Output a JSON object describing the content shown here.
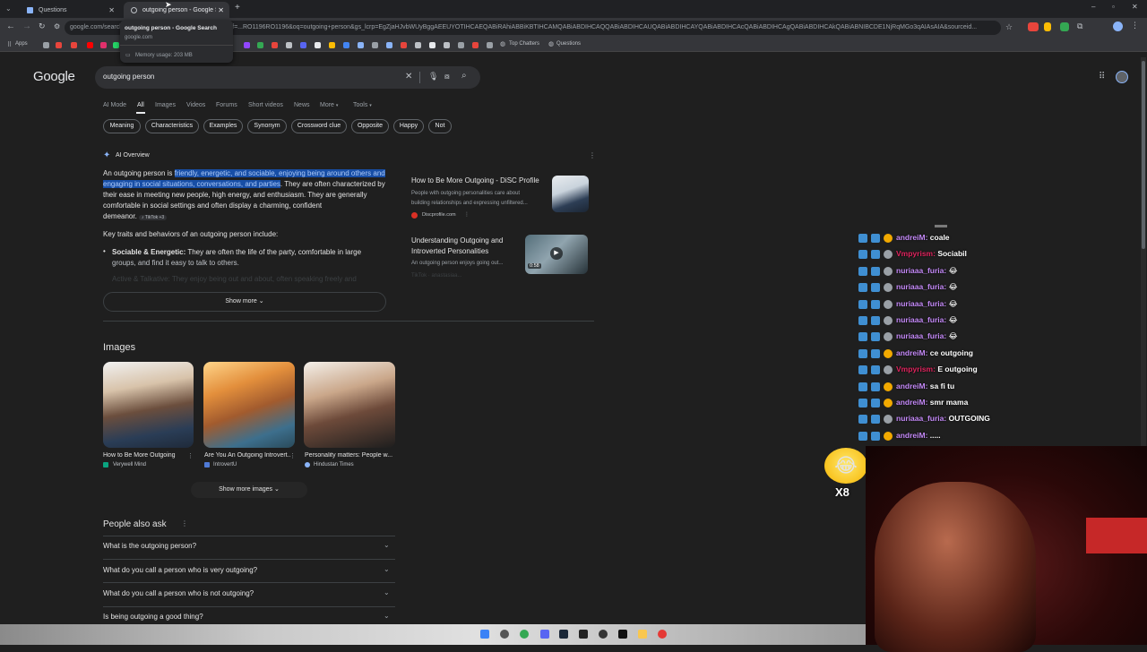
{
  "browser": {
    "tabs": [
      {
        "label": "Questions"
      },
      {
        "label": "outgoing person - Google Search"
      }
    ],
    "url": "google.com/search?q=outgoing+person&sca_esv=...&sxsrf=...RO1196RO1196&oq=outgoing+person&gs_lcrp=EgZjaHJvbWUyBggAEEUYOTIHCAEQABiRAhiABBiKBTIHCAMQABiABDIHCAQQABiABDIHCAUQABiABDIHCAYQABiABDIHCAcQABiABDIHCAgQABiABDIHCAkQABiABNIBCDE1NjRqMGo3qAIAsAIA&sourceid...",
    "hover_card": {
      "title": "outgoing person - Google Search",
      "domain": "google.com",
      "memory": "Memory usage: 203 MB"
    },
    "bookmarks": {
      "apps": "Apps",
      "top_chatters": "Top Chatters",
      "questions": "Questions"
    }
  },
  "google": {
    "logo": "Google",
    "query": "outgoing person",
    "nav_tabs": [
      "AI Mode",
      "All",
      "Images",
      "Videos",
      "Forums",
      "Short videos",
      "News",
      "More",
      "Tools"
    ],
    "chips": [
      "Meaning",
      "Characteristics",
      "Examples",
      "Synonym",
      "Crossword clue",
      "Opposite",
      "Happy",
      "Not"
    ],
    "ai_overview": {
      "heading": "AI Overview",
      "intro_start": "An outgoing person is ",
      "intro_hl1": "friendly, energetic, and sociable, enjoying being around others and",
      "intro_hl2": "engaging in social situations, conversations, and parties",
      "intro_rest1": ". They are often characterized by",
      "intro_rest2": "their ease in meeting new people, high energy, and enthusiasm. They are generally",
      "intro_rest3": "comfortable in social settings and often display a charming, confident",
      "intro_rest4": "demeanor.",
      "tiktok_tag": "TikTok +3",
      "traits_heading": "Key traits and behaviors of an outgoing person include:",
      "trait1_bold": "Sociable & Energetic:",
      "trait1_text": " They are often the life of the party, comfortable in large",
      "trait1_text2": "groups, and find it easy to talk to others.",
      "trait2_faded": "Active & Talkative: They enjoy being out and about, often speaking freely and",
      "show_more": "Show more",
      "cards": [
        {
          "title": "How to Be More Outgoing - DiSC Profile",
          "desc1": "People with outgoing personalities care about",
          "desc2": "building relationships and expressing unfiltered...",
          "source": "Discprofile.com"
        },
        {
          "title": "Understanding Outgoing and",
          "title2": "Introverted Personalities",
          "desc1": "An outgoing person enjoys going out...",
          "source": "TikTok · anastasiaa...",
          "duration": "0:58"
        }
      ]
    },
    "images": {
      "heading": "Images",
      "items": [
        {
          "caption": "How to Be More Outgoing",
          "source": "Verywell Mind"
        },
        {
          "caption": "Are You An Outgoing Introvert...",
          "source": "IntrovertU"
        },
        {
          "caption": "Personality matters: People w...",
          "source": "Hindustan Times"
        }
      ],
      "show_more": "Show more images"
    },
    "paa": {
      "heading": "People also ask",
      "questions": [
        "What is the outgoing person?",
        "What do you call a person who is very outgoing?",
        "What do you call a person who is not outgoing?",
        "Is being outgoing a good thing?"
      ]
    }
  },
  "chat": [
    {
      "user": "andreiM",
      "msg": "coale",
      "color": "#c58af9"
    },
    {
      "user": "Vmpyrism",
      "msg": "Sociabil",
      "color": "#e0245e"
    },
    {
      "user": "nuriaaa_furia",
      "msg": "😂",
      "color": "#c58af9"
    },
    {
      "user": "nuriaaa_furia",
      "msg": "😂",
      "color": "#c58af9"
    },
    {
      "user": "nuriaaa_furia",
      "msg": "😂",
      "color": "#c58af9"
    },
    {
      "user": "nuriaaa_furia",
      "msg": "😂",
      "color": "#c58af9"
    },
    {
      "user": "nuriaaa_furia",
      "msg": "😂",
      "color": "#c58af9"
    },
    {
      "user": "andreiM",
      "msg": "ce outgoing",
      "color": "#c58af9"
    },
    {
      "user": "Vmpyrism",
      "msg": "E outgoing",
      "color": "#e0245e"
    },
    {
      "user": "andreiM",
      "msg": "sa fi tu",
      "color": "#c58af9"
    },
    {
      "user": "andreiM",
      "msg": "smr mama",
      "color": "#c58af9"
    },
    {
      "user": "nuriaaa_furia",
      "msg": "OUTGOING",
      "color": "#c58af9"
    },
    {
      "user": "andreiM",
      "msg": ".....",
      "color": "#c58af9"
    }
  ],
  "emote_counter": "X8"
}
